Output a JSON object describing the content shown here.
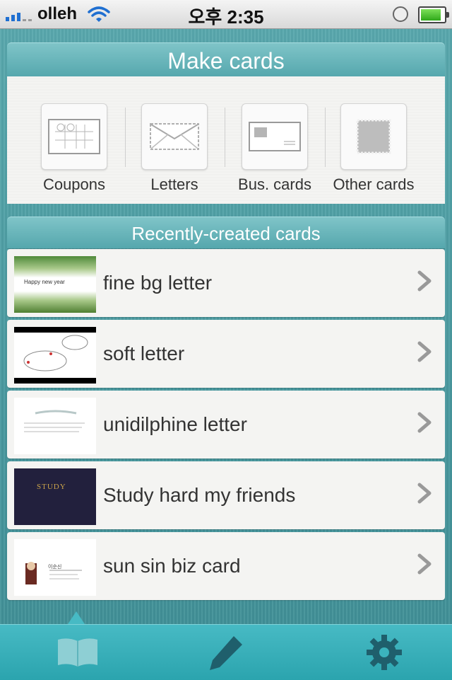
{
  "status_bar": {
    "carrier": "olleh",
    "time": "오후 2:35"
  },
  "make_cards": {
    "title": "Make cards",
    "items": [
      {
        "label": "Coupons",
        "icon": "coupon-icon"
      },
      {
        "label": "Letters",
        "icon": "envelope-icon"
      },
      {
        "label": "Bus. cards",
        "icon": "business-card-icon"
      },
      {
        "label": "Other cards",
        "icon": "stamp-icon"
      }
    ]
  },
  "recent_cards": {
    "title": "Recently-created cards",
    "items": [
      {
        "label": "fine bg letter",
        "thumb_text": "Happy new year"
      },
      {
        "label": "soft letter"
      },
      {
        "label": "unidilphine letter"
      },
      {
        "label": "Study hard my friends",
        "thumb_text": "STUDY"
      },
      {
        "label": "sun sin biz card",
        "thumb_text": "이순신"
      }
    ]
  },
  "tab_bar": {
    "tabs": [
      {
        "icon": "book-icon",
        "selected": true
      },
      {
        "icon": "pencil-icon",
        "selected": false
      },
      {
        "icon": "gear-icon",
        "selected": false
      }
    ]
  },
  "colors": {
    "accent": "#4fa7ad",
    "tab_bar": "#35aeb8",
    "tab_icon": "#1f5f6c"
  }
}
